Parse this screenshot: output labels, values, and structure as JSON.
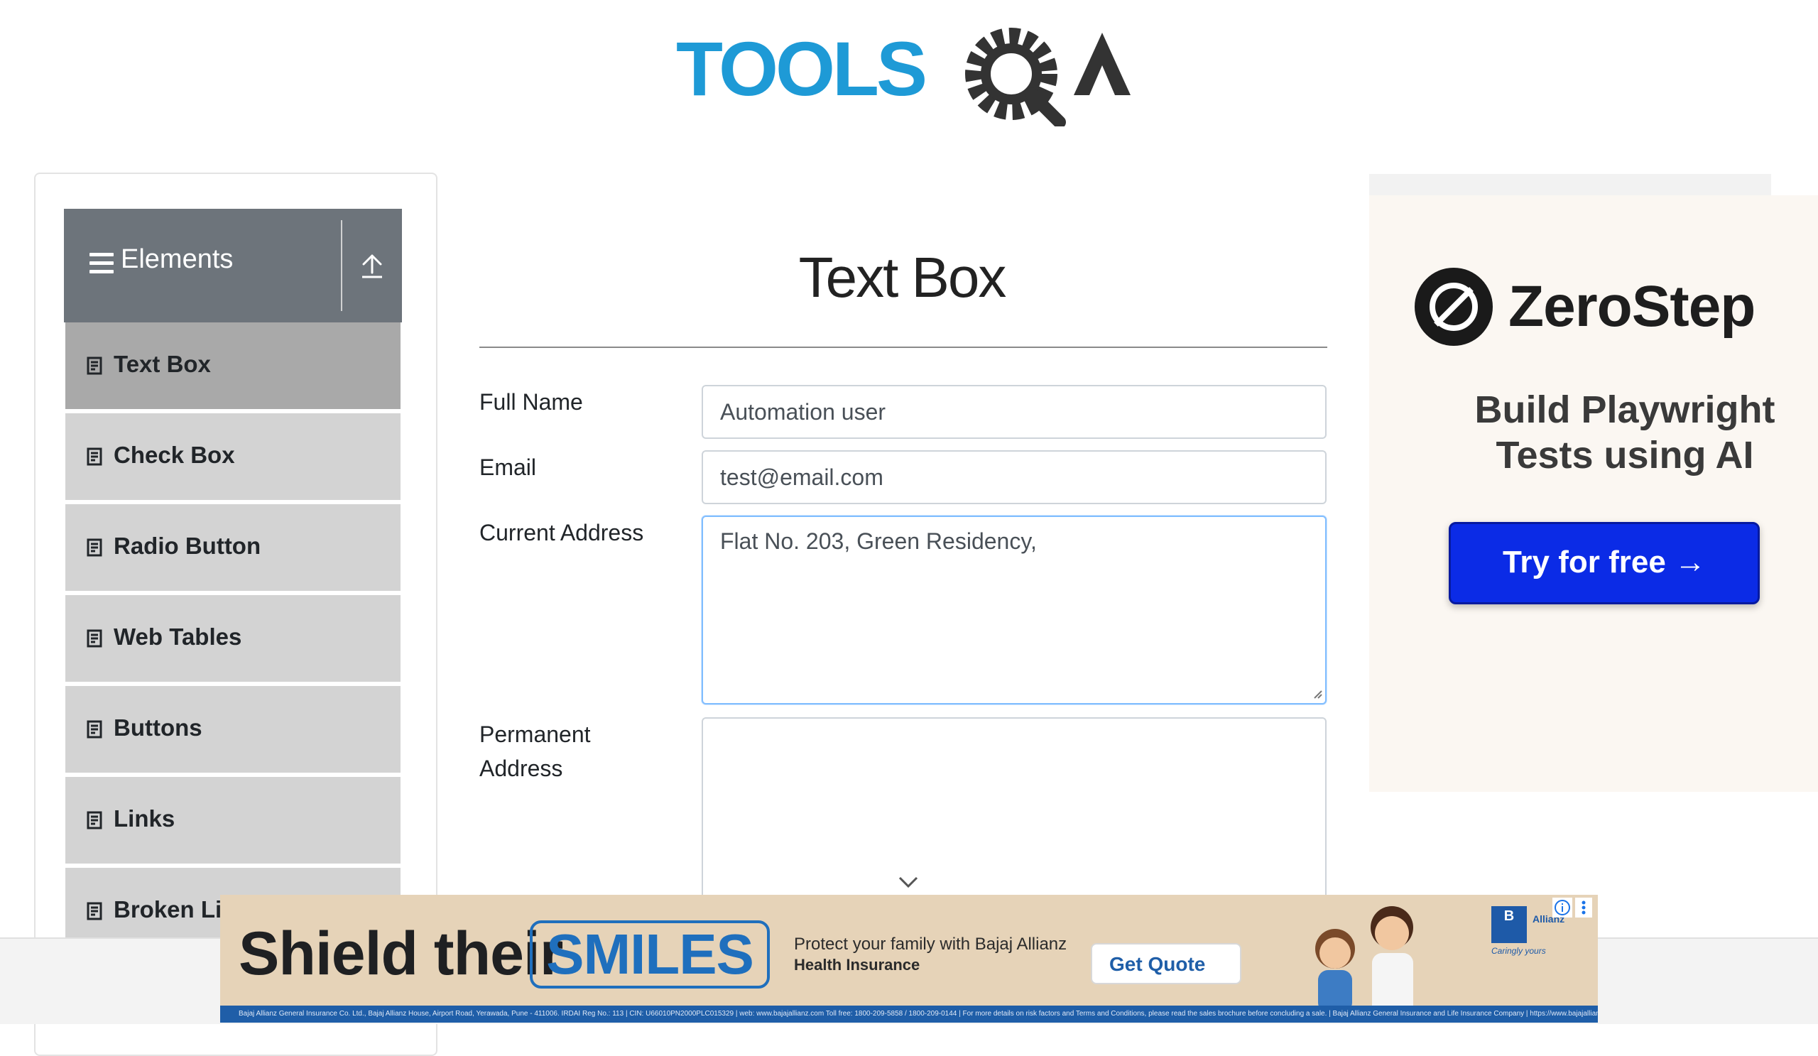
{
  "header": {
    "logo_text": "TOOLSQA"
  },
  "sidebar": {
    "group_title": "Elements",
    "items": [
      {
        "label": "Text Box",
        "active": true
      },
      {
        "label": "Check Box"
      },
      {
        "label": "Radio Button"
      },
      {
        "label": "Web Tables"
      },
      {
        "label": "Buttons"
      },
      {
        "label": "Links"
      },
      {
        "label": "Broken Li"
      }
    ]
  },
  "main": {
    "title": "Text Box",
    "fields": {
      "full_name": {
        "label": "Full Name",
        "value": "Automation user"
      },
      "email": {
        "label": "Email",
        "value": "test@email.com"
      },
      "current_address": {
        "label": "Current Address",
        "value": "Flat No. 203, Green Residency,"
      },
      "permanent_address": {
        "label_line1": "Permanent",
        "label_line2": "Address",
        "value": ""
      }
    }
  },
  "ad_right": {
    "brand": "ZeroStep",
    "tagline_line1": "Build Playwright",
    "tagline_line2": "Tests using AI",
    "cta": "Try for free →"
  },
  "ad_bottom": {
    "headline": "Shield their",
    "highlight": "SMILES",
    "sub_line1": "Protect your family with Bajaj Allianz",
    "sub_line2": "Health Insurance",
    "cta": "Get Quote",
    "brand_mark": "B",
    "brand_name": "Allianz",
    "brand_slogan": "Caringly yours",
    "disclaimer": "Bajaj Allianz General Insurance Co. Ltd., Bajaj Allianz House, Airport Road, Yerawada, Pune - 411006. IRDAI Reg No.: 113 | CIN: U66010PN2000PLC015329 | web: www.bajajallianz.com Toll free: 1800-209-5858 / 1800-209-0144 | For more details on risk factors and Terms and Conditions, please read the sales brochure before concluding a sale. | Bajaj Allianz General Insurance and Life Insurance Company | https://www.bajajallianz.com"
  },
  "colors": {
    "logo_blue": "#1e9ad6",
    "logo_dark": "#333333",
    "sidebar_header": "#6d747b",
    "menu_item": "#d3d3d3",
    "menu_item_active": "#a9a9a9",
    "cta_blue": "#0b2be6"
  },
  "icons": [
    "menu-icon",
    "collapse-up-icon",
    "document-icon",
    "gear-magnifier-icon",
    "chevron-down-icon",
    "ad-info-icon",
    "ad-more-icon"
  ]
}
